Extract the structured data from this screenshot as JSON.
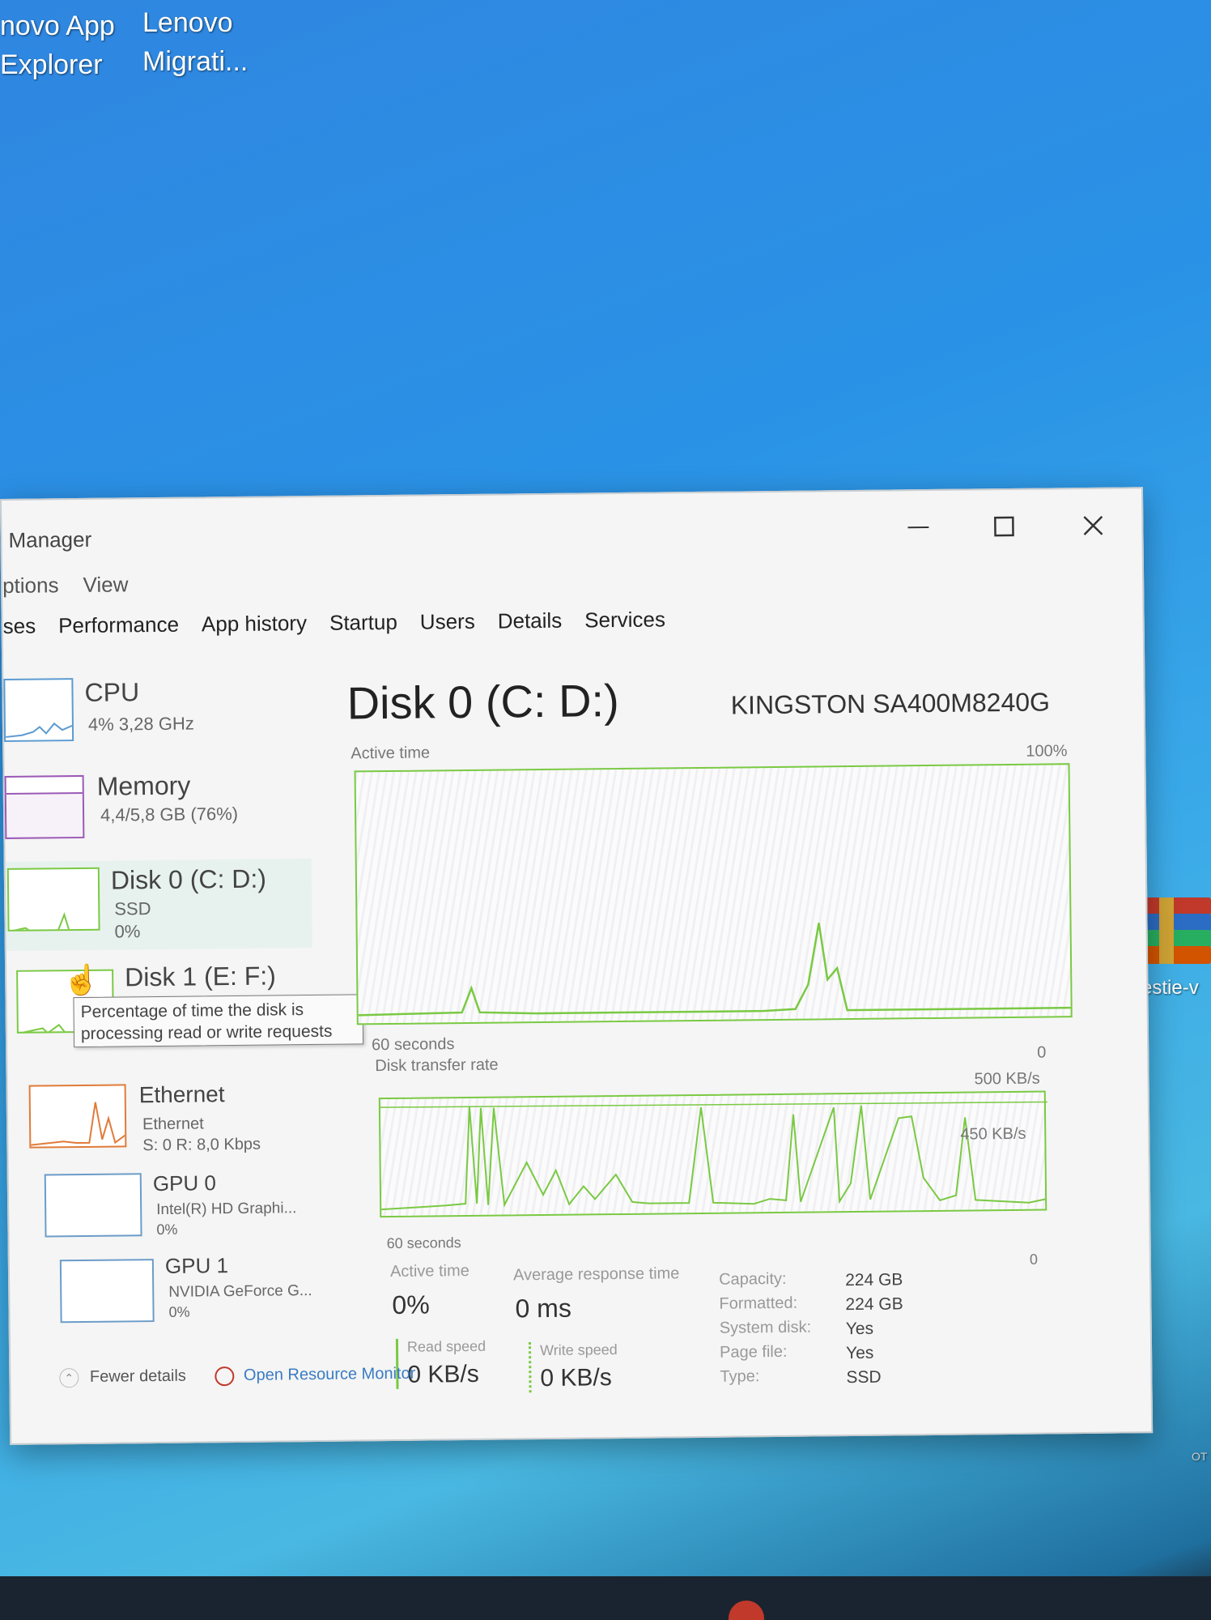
{
  "desktop": {
    "icon1_line1": "novo App",
    "icon1_line2": "Explorer",
    "icon2_line1": "Lenovo",
    "icon2_line2": "Migrati...",
    "icon3_label": "Questie-v",
    "corner_text": "OT"
  },
  "window": {
    "title": "Manager",
    "menu": [
      "ptions",
      "View"
    ],
    "tabs": [
      "ses",
      "Performance",
      "App history",
      "Startup",
      "Users",
      "Details",
      "Services"
    ]
  },
  "sidebar": {
    "cpu": {
      "title": "CPU",
      "sub": "4% 3,28 GHz"
    },
    "memory": {
      "title": "Memory",
      "sub": "4,4/5,8 GB (76%)"
    },
    "disk0": {
      "title": "Disk 0 (C: D:)",
      "type": "SSD",
      "value": "0%"
    },
    "disk1": {
      "title": "Disk 1 (E: F:)"
    },
    "ethernet": {
      "title": "Ethernet",
      "sub": "Ethernet",
      "rate": "S: 0 R: 8,0 Kbps"
    },
    "gpu0": {
      "title": "GPU 0",
      "sub": "Intel(R) HD Graphi...",
      "value": "0%"
    },
    "gpu1": {
      "title": "GPU 1",
      "sub": "NVIDIA GeForce G...",
      "value": "0%"
    }
  },
  "tooltip": {
    "line1": "Percentage of time the disk is",
    "line2": "processing read or write requests"
  },
  "detail": {
    "title": "Disk 0 (C: D:)",
    "model": "KINGSTON SA400M8240G",
    "graph1": {
      "label": "Active time",
      "max": "100%",
      "min": "0",
      "time": "60 seconds"
    },
    "graph2": {
      "label": "Disk transfer rate",
      "max": "500 KB/s",
      "mid": "450 KB/s",
      "min": "0",
      "time": "60 seconds"
    },
    "stats": {
      "active_label": "Active time",
      "active_value": "0%",
      "response_label": "Average response time",
      "response_value": "0 ms",
      "read_label": "Read speed",
      "read_value": "0 KB/s",
      "write_label": "Write speed",
      "write_value": "0 KB/s"
    },
    "props": [
      {
        "label": "Capacity:",
        "value": "224 GB"
      },
      {
        "label": "Formatted:",
        "value": "224 GB"
      },
      {
        "label": "System disk:",
        "value": "Yes"
      },
      {
        "label": "Page file:",
        "value": "Yes"
      },
      {
        "label": "Type:",
        "value": "SSD"
      }
    ]
  },
  "footer": {
    "fewer": "Fewer details",
    "monitor": "Open Resource Monitor"
  },
  "colors": {
    "graph_green": "#7ac943",
    "ethernet_orange": "#e07b39",
    "memory_purple": "#9b59b6",
    "gpu_blue": "#6b9cc8"
  }
}
